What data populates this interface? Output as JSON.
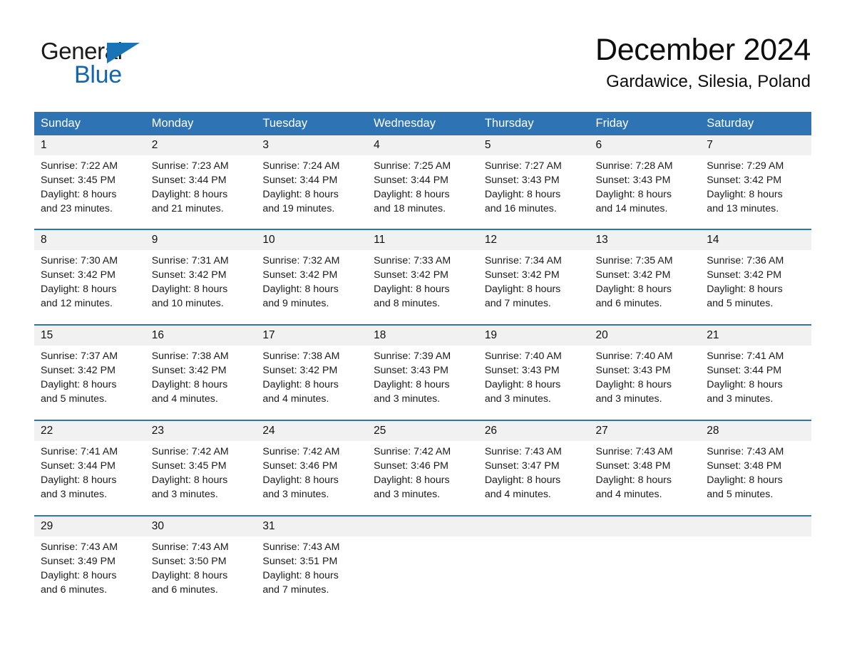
{
  "brand": {
    "name_part1": "General",
    "name_part2": "Blue",
    "triangle_color": "#1a73b5",
    "blue_color": "#1565ad"
  },
  "header": {
    "month_title": "December 2024",
    "location": "Gardawice, Silesia, Poland"
  },
  "theme": {
    "header_blue": "#2e74b5",
    "daynum_gray": "#f1f1f1",
    "text_black": "#1a1a1a"
  },
  "weekday_headers": [
    "Sunday",
    "Monday",
    "Tuesday",
    "Wednesday",
    "Thursday",
    "Friday",
    "Saturday"
  ],
  "weeks": [
    [
      {
        "day": "1",
        "sunrise": "Sunrise: 7:22 AM",
        "sunset": "Sunset: 3:45 PM",
        "daylight_line1": "Daylight: 8 hours",
        "daylight_line2": "and 23 minutes."
      },
      {
        "day": "2",
        "sunrise": "Sunrise: 7:23 AM",
        "sunset": "Sunset: 3:44 PM",
        "daylight_line1": "Daylight: 8 hours",
        "daylight_line2": "and 21 minutes."
      },
      {
        "day": "3",
        "sunrise": "Sunrise: 7:24 AM",
        "sunset": "Sunset: 3:44 PM",
        "daylight_line1": "Daylight: 8 hours",
        "daylight_line2": "and 19 minutes."
      },
      {
        "day": "4",
        "sunrise": "Sunrise: 7:25 AM",
        "sunset": "Sunset: 3:44 PM",
        "daylight_line1": "Daylight: 8 hours",
        "daylight_line2": "and 18 minutes."
      },
      {
        "day": "5",
        "sunrise": "Sunrise: 7:27 AM",
        "sunset": "Sunset: 3:43 PM",
        "daylight_line1": "Daylight: 8 hours",
        "daylight_line2": "and 16 minutes."
      },
      {
        "day": "6",
        "sunrise": "Sunrise: 7:28 AM",
        "sunset": "Sunset: 3:43 PM",
        "daylight_line1": "Daylight: 8 hours",
        "daylight_line2": "and 14 minutes."
      },
      {
        "day": "7",
        "sunrise": "Sunrise: 7:29 AM",
        "sunset": "Sunset: 3:42 PM",
        "daylight_line1": "Daylight: 8 hours",
        "daylight_line2": "and 13 minutes."
      }
    ],
    [
      {
        "day": "8",
        "sunrise": "Sunrise: 7:30 AM",
        "sunset": "Sunset: 3:42 PM",
        "daylight_line1": "Daylight: 8 hours",
        "daylight_line2": "and 12 minutes."
      },
      {
        "day": "9",
        "sunrise": "Sunrise: 7:31 AM",
        "sunset": "Sunset: 3:42 PM",
        "daylight_line1": "Daylight: 8 hours",
        "daylight_line2": "and 10 minutes."
      },
      {
        "day": "10",
        "sunrise": "Sunrise: 7:32 AM",
        "sunset": "Sunset: 3:42 PM",
        "daylight_line1": "Daylight: 8 hours",
        "daylight_line2": "and 9 minutes."
      },
      {
        "day": "11",
        "sunrise": "Sunrise: 7:33 AM",
        "sunset": "Sunset: 3:42 PM",
        "daylight_line1": "Daylight: 8 hours",
        "daylight_line2": "and 8 minutes."
      },
      {
        "day": "12",
        "sunrise": "Sunrise: 7:34 AM",
        "sunset": "Sunset: 3:42 PM",
        "daylight_line1": "Daylight: 8 hours",
        "daylight_line2": "and 7 minutes."
      },
      {
        "day": "13",
        "sunrise": "Sunrise: 7:35 AM",
        "sunset": "Sunset: 3:42 PM",
        "daylight_line1": "Daylight: 8 hours",
        "daylight_line2": "and 6 minutes."
      },
      {
        "day": "14",
        "sunrise": "Sunrise: 7:36 AM",
        "sunset": "Sunset: 3:42 PM",
        "daylight_line1": "Daylight: 8 hours",
        "daylight_line2": "and 5 minutes."
      }
    ],
    [
      {
        "day": "15",
        "sunrise": "Sunrise: 7:37 AM",
        "sunset": "Sunset: 3:42 PM",
        "daylight_line1": "Daylight: 8 hours",
        "daylight_line2": "and 5 minutes."
      },
      {
        "day": "16",
        "sunrise": "Sunrise: 7:38 AM",
        "sunset": "Sunset: 3:42 PM",
        "daylight_line1": "Daylight: 8 hours",
        "daylight_line2": "and 4 minutes."
      },
      {
        "day": "17",
        "sunrise": "Sunrise: 7:38 AM",
        "sunset": "Sunset: 3:42 PM",
        "daylight_line1": "Daylight: 8 hours",
        "daylight_line2": "and 4 minutes."
      },
      {
        "day": "18",
        "sunrise": "Sunrise: 7:39 AM",
        "sunset": "Sunset: 3:43 PM",
        "daylight_line1": "Daylight: 8 hours",
        "daylight_line2": "and 3 minutes."
      },
      {
        "day": "19",
        "sunrise": "Sunrise: 7:40 AM",
        "sunset": "Sunset: 3:43 PM",
        "daylight_line1": "Daylight: 8 hours",
        "daylight_line2": "and 3 minutes."
      },
      {
        "day": "20",
        "sunrise": "Sunrise: 7:40 AM",
        "sunset": "Sunset: 3:43 PM",
        "daylight_line1": "Daylight: 8 hours",
        "daylight_line2": "and 3 minutes."
      },
      {
        "day": "21",
        "sunrise": "Sunrise: 7:41 AM",
        "sunset": "Sunset: 3:44 PM",
        "daylight_line1": "Daylight: 8 hours",
        "daylight_line2": "and 3 minutes."
      }
    ],
    [
      {
        "day": "22",
        "sunrise": "Sunrise: 7:41 AM",
        "sunset": "Sunset: 3:44 PM",
        "daylight_line1": "Daylight: 8 hours",
        "daylight_line2": "and 3 minutes."
      },
      {
        "day": "23",
        "sunrise": "Sunrise: 7:42 AM",
        "sunset": "Sunset: 3:45 PM",
        "daylight_line1": "Daylight: 8 hours",
        "daylight_line2": "and 3 minutes."
      },
      {
        "day": "24",
        "sunrise": "Sunrise: 7:42 AM",
        "sunset": "Sunset: 3:46 PM",
        "daylight_line1": "Daylight: 8 hours",
        "daylight_line2": "and 3 minutes."
      },
      {
        "day": "25",
        "sunrise": "Sunrise: 7:42 AM",
        "sunset": "Sunset: 3:46 PM",
        "daylight_line1": "Daylight: 8 hours",
        "daylight_line2": "and 3 minutes."
      },
      {
        "day": "26",
        "sunrise": "Sunrise: 7:43 AM",
        "sunset": "Sunset: 3:47 PM",
        "daylight_line1": "Daylight: 8 hours",
        "daylight_line2": "and 4 minutes."
      },
      {
        "day": "27",
        "sunrise": "Sunrise: 7:43 AM",
        "sunset": "Sunset: 3:48 PM",
        "daylight_line1": "Daylight: 8 hours",
        "daylight_line2": "and 4 minutes."
      },
      {
        "day": "28",
        "sunrise": "Sunrise: 7:43 AM",
        "sunset": "Sunset: 3:48 PM",
        "daylight_line1": "Daylight: 8 hours",
        "daylight_line2": "and 5 minutes."
      }
    ],
    [
      {
        "day": "29",
        "sunrise": "Sunrise: 7:43 AM",
        "sunset": "Sunset: 3:49 PM",
        "daylight_line1": "Daylight: 8 hours",
        "daylight_line2": "and 6 minutes."
      },
      {
        "day": "30",
        "sunrise": "Sunrise: 7:43 AM",
        "sunset": "Sunset: 3:50 PM",
        "daylight_line1": "Daylight: 8 hours",
        "daylight_line2": "and 6 minutes."
      },
      {
        "day": "31",
        "sunrise": "Sunrise: 7:43 AM",
        "sunset": "Sunset: 3:51 PM",
        "daylight_line1": "Daylight: 8 hours",
        "daylight_line2": "and 7 minutes."
      },
      {
        "day": "",
        "sunrise": "",
        "sunset": "",
        "daylight_line1": "",
        "daylight_line2": ""
      },
      {
        "day": "",
        "sunrise": "",
        "sunset": "",
        "daylight_line1": "",
        "daylight_line2": ""
      },
      {
        "day": "",
        "sunrise": "",
        "sunset": "",
        "daylight_line1": "",
        "daylight_line2": ""
      },
      {
        "day": "",
        "sunrise": "",
        "sunset": "",
        "daylight_line1": "",
        "daylight_line2": ""
      }
    ]
  ]
}
